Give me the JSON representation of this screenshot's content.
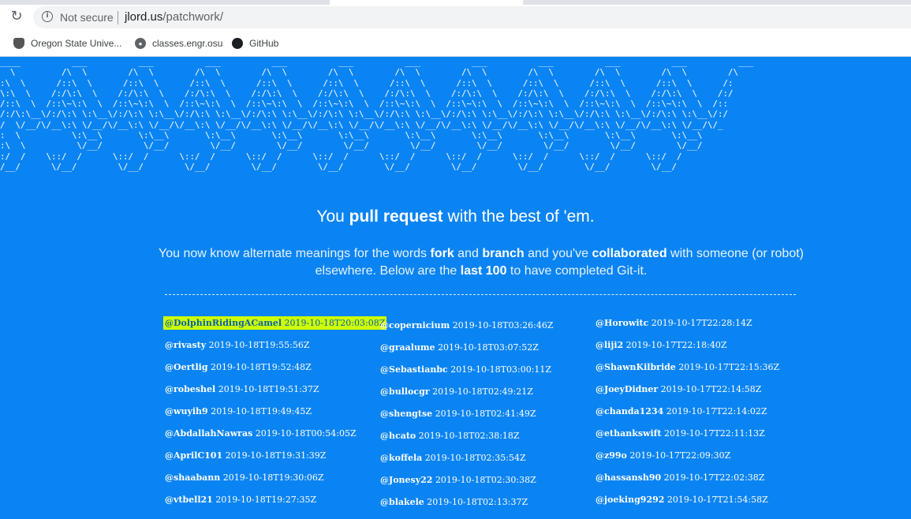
{
  "browser": {
    "security_label": "Not secure",
    "url_host": "jlord.us",
    "url_path": "/patchwork/",
    "bookmarks": [
      {
        "label": "Oregon State Unive...",
        "icon": "osu-logo-icon"
      },
      {
        "label": "classes.engr.osu",
        "icon": "globe-icon"
      },
      {
        "label": "GitHub",
        "icon": "github-icon"
      }
    ]
  },
  "page": {
    "headline": {
      "pre": "You ",
      "bold": "pull request",
      "post": " with the best of 'em."
    },
    "subtitle": {
      "t1": "You now know alternate meanings for the words ",
      "b1": "fork",
      "t2": " and ",
      "b2": "branch",
      "t3": " and you've ",
      "b3": "collaborated",
      "t4": " with someone (or robot) elsewhere. Below are the ",
      "b4": "last 100",
      "t5": " to have completed Git-it."
    },
    "columns": [
      [
        {
          "user": "@DolphinRidingACamel",
          "time": "2019-10-18T20:03:08Z",
          "highlighted": true
        },
        {
          "user": "@rivasty",
          "time": "2019-10-18T19:55:56Z"
        },
        {
          "user": "@Oertlig",
          "time": "2019-10-18T19:52:48Z"
        },
        {
          "user": "@robeshel",
          "time": "2019-10-18T19:51:37Z"
        },
        {
          "user": "@wuyih9",
          "time": "2019-10-18T19:49:45Z"
        },
        {
          "user": "@AbdallahNawras",
          "time": "2019-10-18T00:54:05Z"
        },
        {
          "user": "@AprilC101",
          "time": "2019-10-18T19:31:39Z"
        },
        {
          "user": "@shaabann",
          "time": "2019-10-18T19:30:06Z"
        },
        {
          "user": "@vtbell21",
          "time": "2019-10-18T19:27:35Z"
        }
      ],
      [
        {
          "user": "@copernicium",
          "time": "2019-10-18T03:26:46Z"
        },
        {
          "user": "@graalume",
          "time": "2019-10-18T03:07:52Z"
        },
        {
          "user": "@Sebastianbc",
          "time": "2019-10-18T03:00:11Z"
        },
        {
          "user": "@bullocgr",
          "time": "2019-10-18T02:49:21Z"
        },
        {
          "user": "@shengtse",
          "time": "2019-10-18T02:41:49Z"
        },
        {
          "user": "@hcato",
          "time": "2019-10-18T02:38:18Z"
        },
        {
          "user": "@koffela",
          "time": "2019-10-18T02:35:54Z"
        },
        {
          "user": "@Jonesy22",
          "time": "2019-10-18T02:30:38Z"
        },
        {
          "user": "@blakele",
          "time": "2019-10-18T02:13:37Z"
        }
      ],
      [
        {
          "user": "@Horowitc",
          "time": "2019-10-17T22:28:14Z"
        },
        {
          "user": "@liji2",
          "time": "2019-10-17T22:18:40Z"
        },
        {
          "user": "@ShawnKilbride",
          "time": "2019-10-17T22:15:36Z"
        },
        {
          "user": "@JoeyDidner",
          "time": "2019-10-17T22:14:58Z"
        },
        {
          "user": "@chanda1234",
          "time": "2019-10-17T22:14:02Z"
        },
        {
          "user": "@ethankswift",
          "time": "2019-10-17T22:11:13Z"
        },
        {
          "user": "@z99o",
          "time": "2019-10-17T22:09:30Z"
        },
        {
          "user": "@hassansh90",
          "time": "2019-10-17T22:02:38Z"
        },
        {
          "user": "@joeking9292",
          "time": "2019-10-17T21:54:58Z"
        }
      ]
    ]
  }
}
